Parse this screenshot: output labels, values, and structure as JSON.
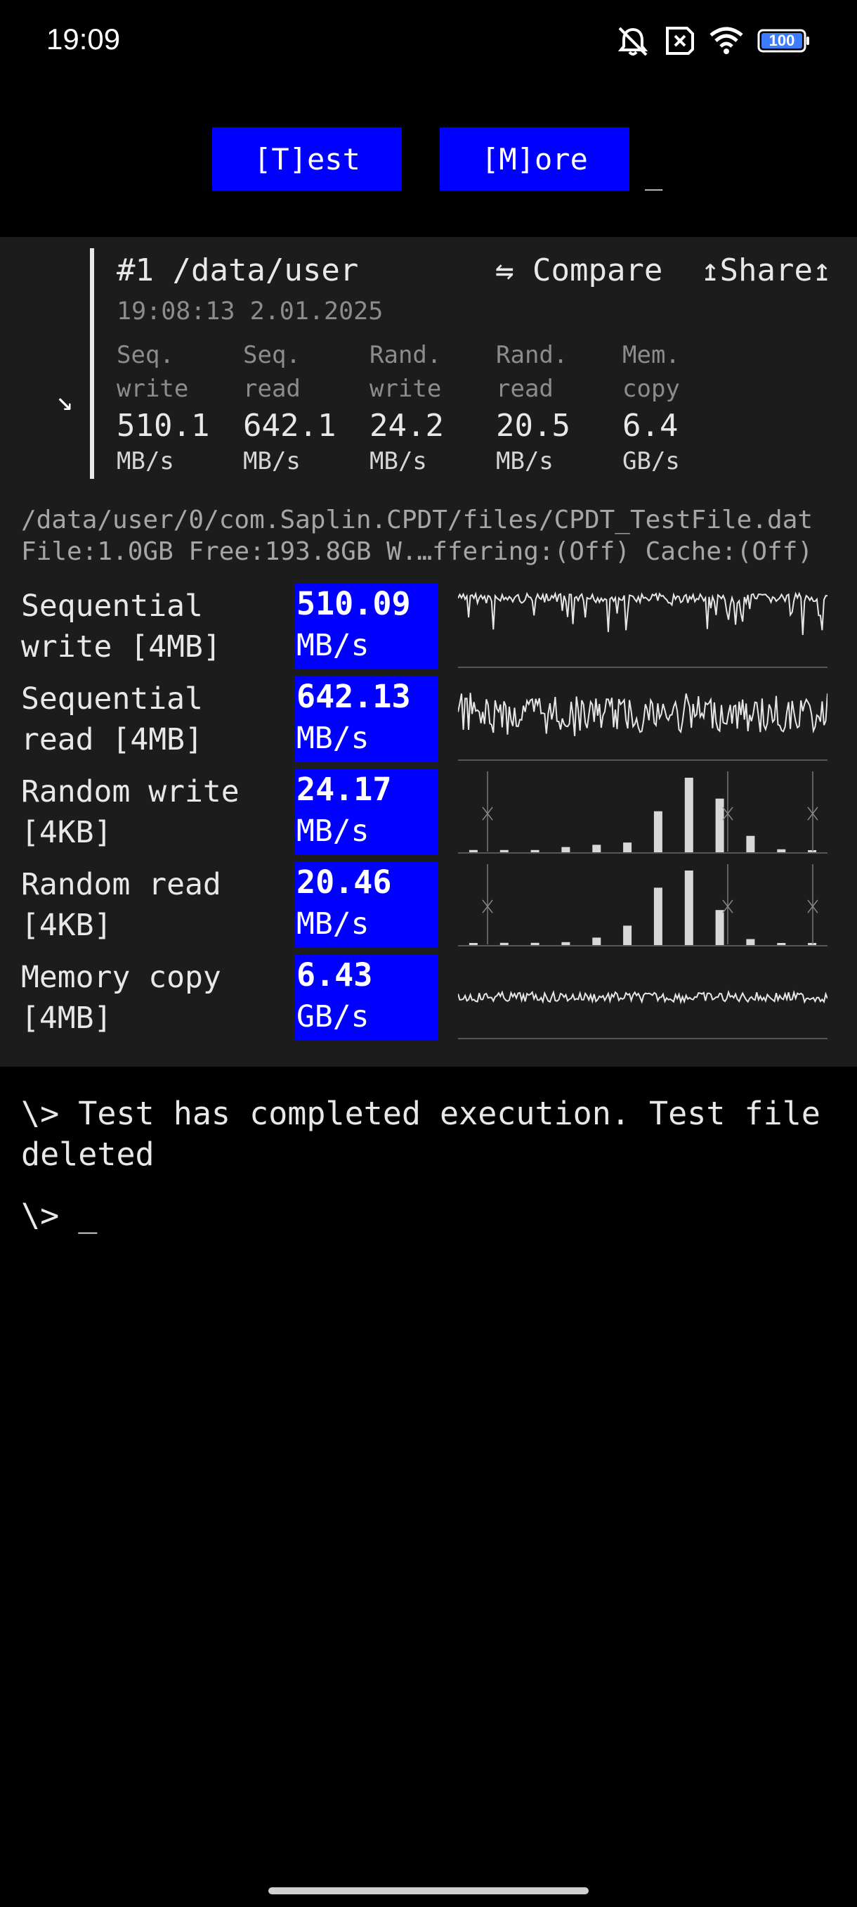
{
  "status_bar": {
    "time": "19:09",
    "battery": "100",
    "icons": [
      "bell-muted-icon",
      "sim-x-icon",
      "wifi-icon",
      "battery-icon"
    ]
  },
  "toolbar": {
    "test_label": "[T]est",
    "more_label": "[M]ore",
    "cursor": "_"
  },
  "result": {
    "title": "#1 /data/user",
    "compare_label": "⇋ Compare",
    "share_label": "↥Share↥",
    "timestamp": "19:08:13 2.01.2025",
    "arrow": "↘",
    "summary": [
      {
        "label": "Seq.\nwrite",
        "value": "510.1",
        "unit": "MB/s"
      },
      {
        "label": "Seq.\nread",
        "value": "642.1",
        "unit": "MB/s"
      },
      {
        "label": "Rand.\nwrite",
        "value": "24.2",
        "unit": "MB/s"
      },
      {
        "label": "Rand.\nread",
        "value": "20.5",
        "unit": "MB/s"
      },
      {
        "label": "Mem.\ncopy",
        "value": "6.4",
        "unit": "GB/s"
      }
    ],
    "path": "/data/user/0/com.Saplin.CPDT/files/CPDT_TestFile.dat",
    "file_info": "File:1.0GB Free:193.8GB W.…ffering:(Off) Cache:(Off)",
    "tests": [
      {
        "label": "Sequential\nwrite [4MB]",
        "value": "510.09",
        "unit": "MB/s",
        "graph": "line",
        "level": 0.82
      },
      {
        "label": "Sequential\nread [4MB]",
        "value": "642.13",
        "unit": "MB/s",
        "graph": "line",
        "level": 0.55
      },
      {
        "label": "Random write\n[4KB]",
        "value": "24.17",
        "unit": "MB/s",
        "graph": "bars",
        "bars": [
          0.03,
          0.03,
          0.03,
          0.07,
          0.1,
          0.13,
          0.55,
          1.0,
          0.72,
          0.22,
          0.04,
          0.02
        ]
      },
      {
        "label": "Random read\n[4KB]",
        "value": "20.46",
        "unit": "MB/s",
        "graph": "bars",
        "bars": [
          0.02,
          0.03,
          0.03,
          0.04,
          0.1,
          0.26,
          0.77,
          1.0,
          0.47,
          0.08,
          0.02,
          0.01
        ]
      },
      {
        "label": "Memory copy\n[4MB]",
        "value": "6.43",
        "unit": "GB/s",
        "graph": "line",
        "level": 0.5
      }
    ]
  },
  "console": {
    "message": "\\> Test has completed execution. Test file deleted",
    "prompt": "\\> _"
  },
  "colors": {
    "accent": "#0000ff",
    "panel": "#1c1c1c",
    "background": "#000000"
  }
}
